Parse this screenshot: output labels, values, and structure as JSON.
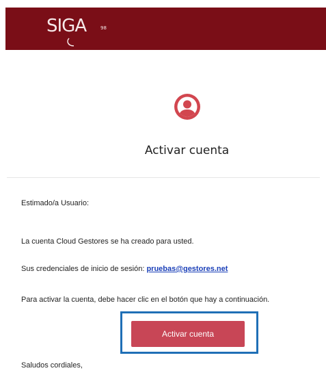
{
  "header": {
    "logo_text": "SIGA",
    "logo_sub": "98",
    "brand_color": "#7a0e17"
  },
  "main": {
    "icon": "user-circle-icon",
    "title": "Activar cuenta",
    "greeting": "Estimado/a Usuario:",
    "account_line": "La cuenta Cloud Gestores se ha creado para usted.",
    "credentials_prefix": "Sus credenciales de inicio de sesión:",
    "credentials_email": "pruebas@gestores.net",
    "instructions": "Para activar la cuenta, debe hacer clic en el botón que hay a continuación.",
    "button_label": "Activar cuenta",
    "closing": "Saludos cordiales,"
  },
  "colors": {
    "accent": "#c84656",
    "highlight": "#1f6fb6",
    "link": "#1a3fb8"
  }
}
